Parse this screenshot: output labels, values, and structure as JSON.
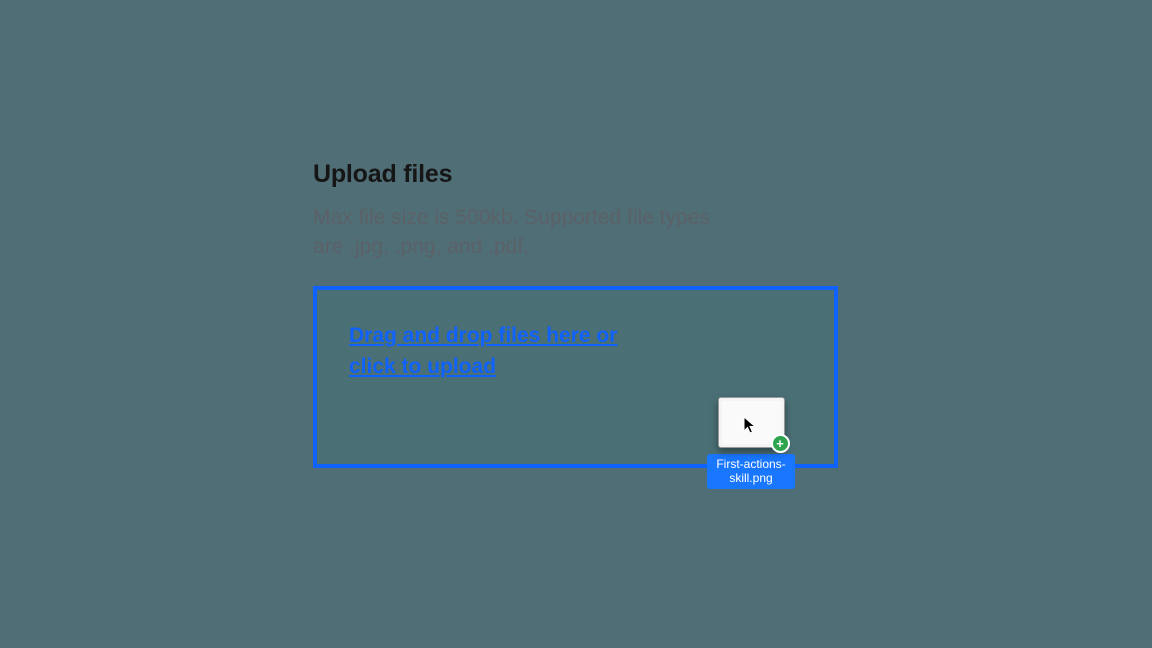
{
  "uploader": {
    "title": "Upload files",
    "description": "Max file size is 500kb. Supported file types are .jpg, .png, and .pdf.",
    "dropzone_text": "Drag and drop files here or click to upload"
  },
  "dragged_file": {
    "name": "First-actions-skill.png",
    "plus_symbol": "+"
  },
  "colors": {
    "accent": "#0f62fe",
    "background": "#4f6e75"
  }
}
